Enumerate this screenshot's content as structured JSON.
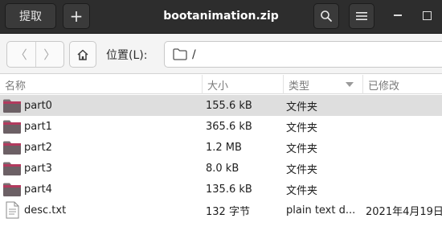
{
  "header": {
    "extract_label": "提取",
    "add_label": "+",
    "title": "bootanimation.zip"
  },
  "location": {
    "back_label": "〈",
    "forward_label": "〉",
    "label": "位置(L):",
    "path": "/"
  },
  "columns": {
    "name": "名称",
    "size": "大小",
    "type": "类型",
    "modified": "已修改"
  },
  "files": [
    {
      "name": "part0",
      "size": "155.6 kB",
      "type": "文件夹",
      "modified": "",
      "icon": "folder-icon",
      "selected": true
    },
    {
      "name": "part1",
      "size": "365.6 kB",
      "type": "文件夹",
      "modified": "",
      "icon": "folder-icon",
      "selected": false
    },
    {
      "name": "part2",
      "size": "1.2 MB",
      "type": "文件夹",
      "modified": "",
      "icon": "folder-icon",
      "selected": false
    },
    {
      "name": "part3",
      "size": "8.0 kB",
      "type": "文件夹",
      "modified": "",
      "icon": "folder-icon",
      "selected": false
    },
    {
      "name": "part4",
      "size": "135.6 kB",
      "type": "文件夹",
      "modified": "",
      "icon": "folder-icon",
      "selected": false
    },
    {
      "name": "desc.txt",
      "size": "132 字节",
      "type": "plain text d...",
      "modified": "2021年4月19日",
      "icon": "text-file-icon",
      "selected": false
    }
  ],
  "colors": {
    "headerbar": "#2d2d2d",
    "folder_body": "#7a6e72",
    "folder_tab": "#b23a5e",
    "selection": "#dedede"
  }
}
